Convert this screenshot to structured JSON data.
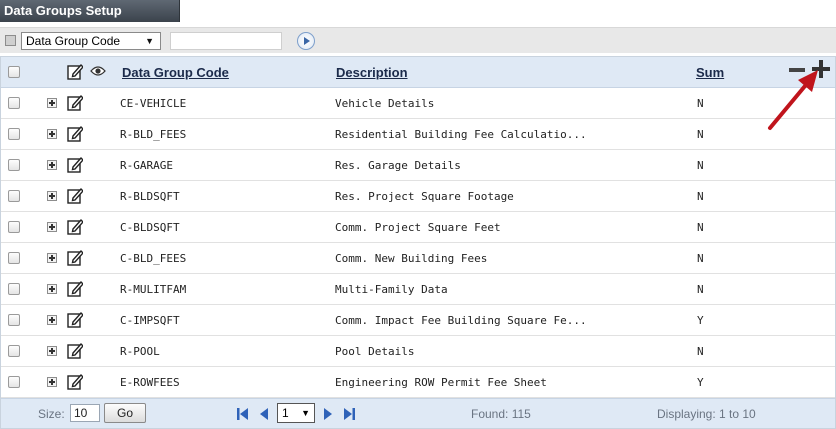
{
  "title": "Data Groups Setup",
  "filter": {
    "field_selected": "Data Group Code",
    "input_value": ""
  },
  "columns": {
    "code": "Data Group Code",
    "description": "Description",
    "sum": "Sum"
  },
  "rows": [
    {
      "code": "CE-VEHICLE",
      "description": "Vehicle Details",
      "sum": "N"
    },
    {
      "code": "R-BLD_FEES",
      "description": "Residential Building Fee Calculatio...",
      "sum": "N"
    },
    {
      "code": "R-GARAGE",
      "description": "Res. Garage Details",
      "sum": "N"
    },
    {
      "code": "R-BLDSQFT",
      "description": "Res. Project Square Footage",
      "sum": "N"
    },
    {
      "code": "C-BLDSQFT",
      "description": "Comm. Project Square Feet",
      "sum": "N"
    },
    {
      "code": "C-BLD_FEES",
      "description": "Comm. New Building Fees",
      "sum": "N"
    },
    {
      "code": "R-MULITFAM",
      "description": "Multi-Family Data",
      "sum": "N"
    },
    {
      "code": "C-IMPSQFT",
      "description": "Comm. Impact Fee Building Square Fe...",
      "sum": "Y"
    },
    {
      "code": "R-POOL",
      "description": "Pool Details",
      "sum": "N"
    },
    {
      "code": "E-ROWFEES",
      "description": "Engineering ROW Permit Fee Sheet",
      "sum": "Y"
    }
  ],
  "footer": {
    "size_label": "Size:",
    "size_value": "10",
    "go_label": "Go",
    "page_value": "1",
    "found_text": "Found: 115",
    "displaying_text": "Displaying: 1 to 10"
  },
  "icons": {
    "expand_all": "expand-all-icon",
    "go": "go-arrow-icon",
    "edit": "edit-icon",
    "view": "eye-icon",
    "collapse": "minus-icon",
    "add": "plus-icon",
    "annotation": "red-arrow-icon",
    "first": "first-page-icon",
    "prev": "prev-page-icon",
    "next": "next-page-icon",
    "last": "last-page-icon"
  },
  "colors": {
    "title_bg": "#4a525c",
    "header_bg": "#dfe9f5",
    "arrow": "#c0141c",
    "pager_blue": "#2f62b8"
  }
}
